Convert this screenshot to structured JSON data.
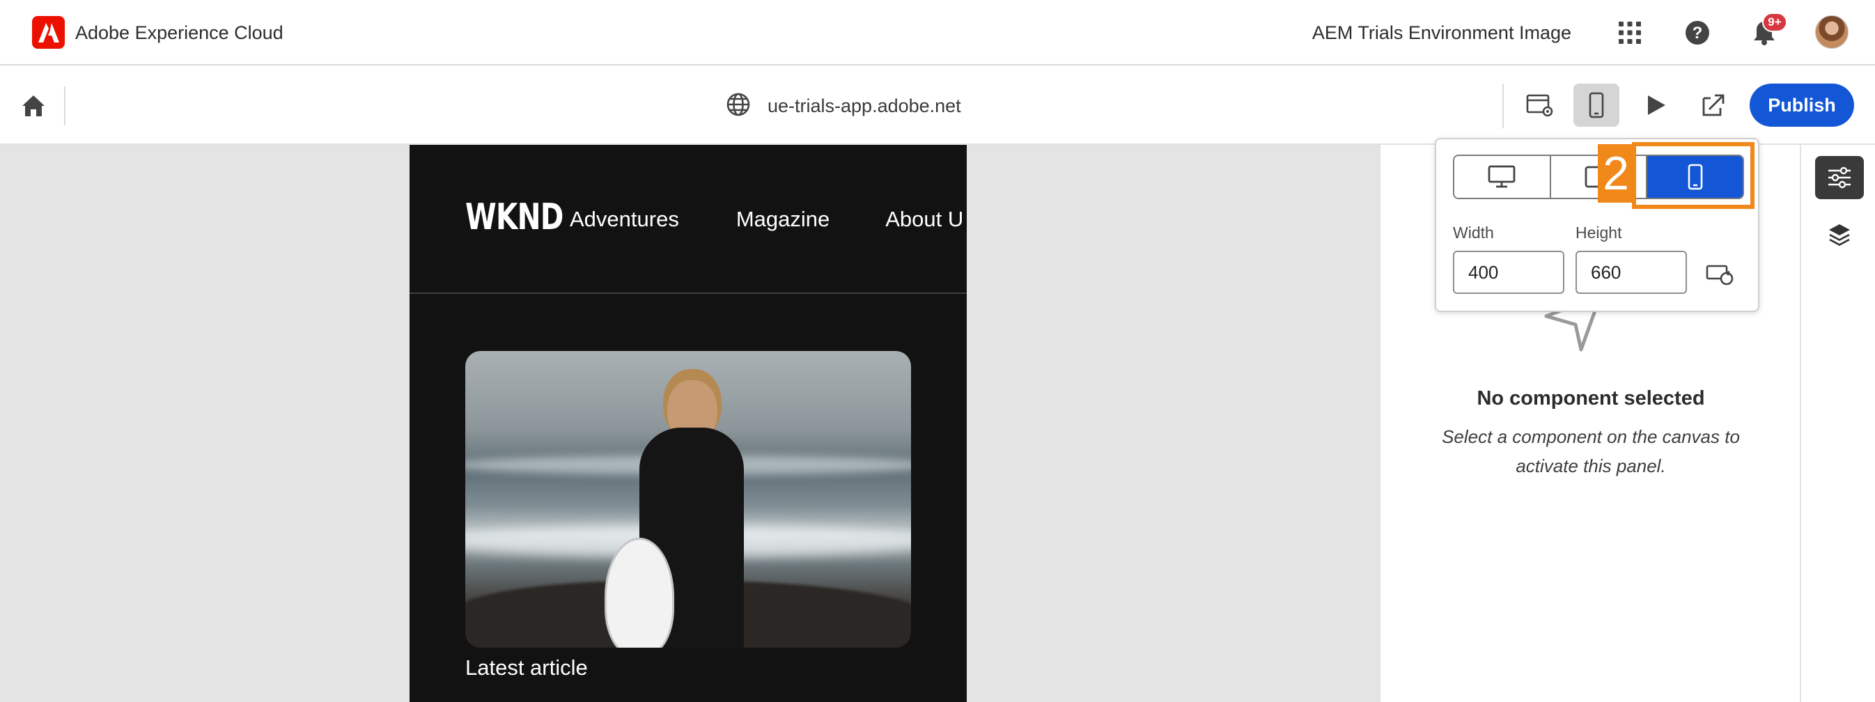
{
  "shell": {
    "brand_title": "Adobe Experience Cloud",
    "org_name": "AEM Trials Environment Image",
    "notification_count": "9+",
    "icons": [
      "adobe-logo-icon",
      "app-grid-icon",
      "help-icon",
      "bell-icon",
      "user-avatar"
    ]
  },
  "toolbar": {
    "url": "ue-trials-app.adobe.net",
    "publish_label": "Publish",
    "active_tool": "emulator"
  },
  "emulator_popover": {
    "devices": [
      "desktop",
      "tablet",
      "mobile"
    ],
    "selected_device": "mobile",
    "width_label": "Width",
    "height_label": "Height",
    "width_value": "400",
    "height_value": "660"
  },
  "site": {
    "logo": "WKND",
    "nav": [
      "Adventures",
      "Magazine",
      "About U"
    ],
    "latest_label": "Latest article"
  },
  "panel": {
    "title": "No component selected",
    "description": "Select a component on the canvas to activate this panel."
  },
  "annotation": {
    "step_number": "2"
  },
  "colors": {
    "accent": "#1356d6",
    "brand_red": "#eb1000",
    "annotation_orange": "#f0881a",
    "badge_red": "#d7373f"
  }
}
